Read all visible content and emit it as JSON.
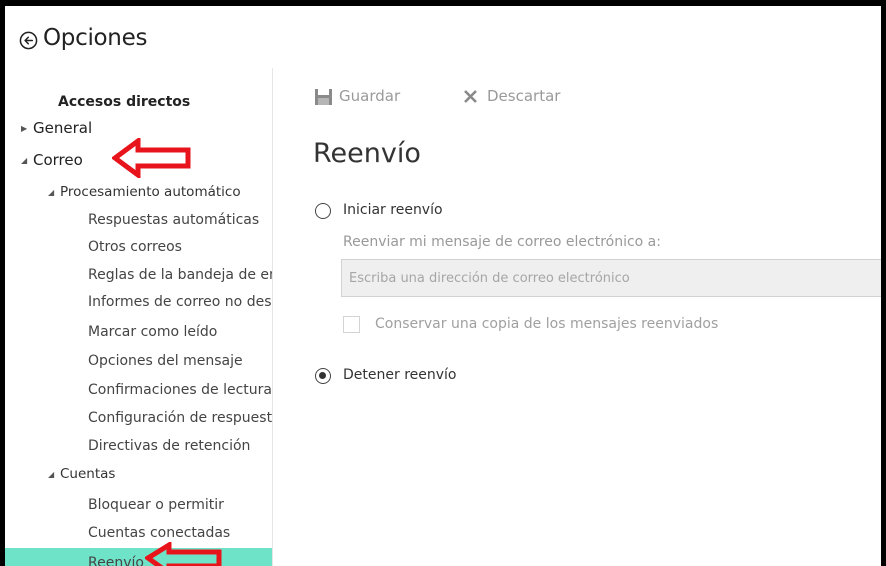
{
  "header": {
    "title": "Opciones"
  },
  "sidebar": {
    "items": [
      {
        "label": "Accesos directos"
      },
      {
        "label": "General"
      },
      {
        "label": "Correo"
      },
      {
        "label": "Procesamiento automático"
      },
      {
        "label": "Respuestas automáticas"
      },
      {
        "label": "Otros correos"
      },
      {
        "label": "Reglas de la bandeja de entrada"
      },
      {
        "label": "Informes de correo no deseado"
      },
      {
        "label": "Marcar como leído"
      },
      {
        "label": "Opciones del mensaje"
      },
      {
        "label": "Confirmaciones de lectura"
      },
      {
        "label": "Configuración de respuesta"
      },
      {
        "label": "Directivas de retención"
      },
      {
        "label": "Cuentas"
      },
      {
        "label": "Bloquear o permitir"
      },
      {
        "label": "Cuentas conectadas"
      },
      {
        "label": "Reenvío"
      }
    ],
    "selected": "Reenvío",
    "selected_color": "#6fe3c8"
  },
  "toolbar": {
    "save_label": "Guardar",
    "discard_label": "Descartar"
  },
  "main": {
    "heading": "Reenvío",
    "start_forwarding_label": "Iniciar reenvío",
    "forward_to_label": "Reenviar mi mensaje de correo electrónico a:",
    "forward_input_placeholder": "Escriba una dirección de correo electrónico",
    "forward_input_value": "",
    "keep_copy_label": "Conservar una copia de los mensajes reenviados",
    "stop_forwarding_label": "Detener reenvío",
    "selected_option": "Detener reenvío"
  },
  "annotation_color": "#e8141b"
}
